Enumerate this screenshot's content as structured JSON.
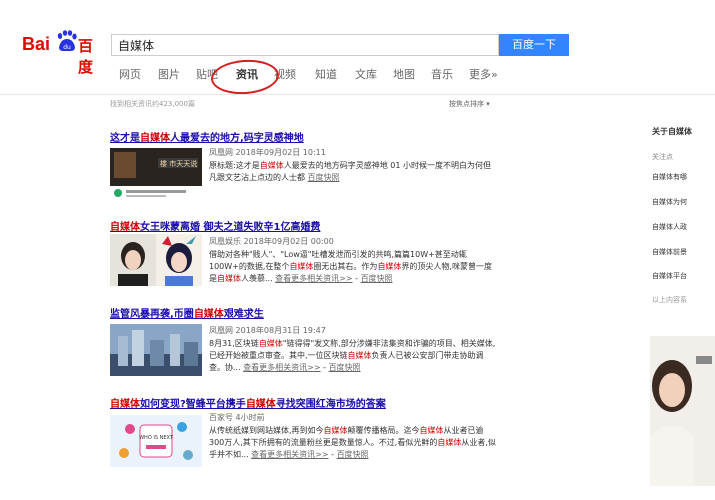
{
  "logo": {
    "latin": "Bai",
    "chinese": "百度",
    "paw_text": "du"
  },
  "search": {
    "value": "自媒体",
    "button": "百度一下"
  },
  "tabs": [
    {
      "label": "网页",
      "active": false
    },
    {
      "label": "图片",
      "active": false
    },
    {
      "label": "贴吧",
      "active": false
    },
    {
      "label": "资讯",
      "active": true
    },
    {
      "label": "视频",
      "active": false
    },
    {
      "label": "知道",
      "active": false
    },
    {
      "label": "文库",
      "active": false
    },
    {
      "label": "地图",
      "active": false
    },
    {
      "label": "音乐",
      "active": false
    },
    {
      "label": "更多»",
      "active": false
    }
  ],
  "result_count": "找到相关资讯约423,000篇",
  "sort_label": "按焦点排序",
  "results": [
    {
      "title_parts": [
        {
          "t": "这才是"
        },
        {
          "t": "自媒体",
          "em": true
        },
        {
          "t": "人最爱去的地方,码字灵感神地"
        }
      ],
      "meta": "凤凰网   2018年09月02日  10:11",
      "snippet": [
        {
          "t": "原标题:这才是"
        },
        {
          "t": "自媒体",
          "em": true
        },
        {
          "t": "人最爱去的地方码字灵感神地 01 小时候一度不明白为何但凡跟文艺沾上点边的人士都 "
        },
        {
          "t": "百度快照",
          "link": true
        }
      ],
      "thumb_text": "楼 市天天说"
    },
    {
      "title_parts": [
        {
          "t": "自媒体",
          "em": true
        },
        {
          "t": "女王咪蒙离婚 御夫之道失败辛1亿高婚费"
        }
      ],
      "meta": "凤凰娱乐   2018年09月02日  00:00",
      "snippet": [
        {
          "t": "借助对各种\"贱人\"、\"Low逼\"吐槽发泄而引发的共鸣,篇篇10W+甚至动辄100W+的数据,在整个"
        },
        {
          "t": "自媒体",
          "em": true
        },
        {
          "t": "圈无出其右。作为"
        },
        {
          "t": "自媒体",
          "em": true
        },
        {
          "t": "界的顶尖人物,咪蒙曾一度是"
        },
        {
          "t": "自媒体",
          "em": true
        },
        {
          "t": "人羡慕... "
        },
        {
          "t": "查看更多相关资讯>>",
          "link": true
        },
        {
          "t": "  -  "
        },
        {
          "t": "百度快照",
          "link": true
        }
      ],
      "thumb_text": ""
    },
    {
      "title_parts": [
        {
          "t": "监管风暴再袭,币圈"
        },
        {
          "t": "自媒体",
          "em": true
        },
        {
          "t": "艰难求生"
        }
      ],
      "meta": "凤凰网   2018年08月31日  19:47",
      "snippet": [
        {
          "t": "8月31,区块链"
        },
        {
          "t": "自媒体",
          "em": true
        },
        {
          "t": "\"链得得\"发文称,部分涉嫌非法集资和诈骗的项目、相关媒体,已经开始被重点审查。其中,一位区块链"
        },
        {
          "t": "自媒体",
          "em": true
        },
        {
          "t": "负责人已被公安部门带走协助调查。协... "
        },
        {
          "t": "查看更多相关资讯>>",
          "link": true
        },
        {
          "t": "  -  "
        },
        {
          "t": "百度快照",
          "link": true
        }
      ],
      "thumb_text": ""
    },
    {
      "title_parts": [
        {
          "t": "自媒体",
          "em": true
        },
        {
          "t": "如何变现?智蜂平台携手"
        },
        {
          "t": "自媒体",
          "em": true
        },
        {
          "t": "寻找突围红海市场的答案"
        }
      ],
      "meta": "百家号   4小时前",
      "snippet": [
        {
          "t": "从传统纸媒到网站媒体,再到如今"
        },
        {
          "t": "自媒体",
          "em": true
        },
        {
          "t": "颠覆传播格局。迄今"
        },
        {
          "t": "自媒体",
          "em": true
        },
        {
          "t": "从业者已逾300万人,其下所拥有的流量粉丝更是数量惊人。不过,看似光鲜的"
        },
        {
          "t": "自媒体",
          "em": true
        },
        {
          "t": "从业者,似乎并不如... "
        },
        {
          "t": "查看更多相关资讯>>",
          "link": true
        },
        {
          "t": "  -  "
        },
        {
          "t": "百度快照",
          "link": true
        }
      ],
      "thumb_text": "WHO IS NEXT"
    }
  ],
  "sidebar": {
    "title": "关于自媒体",
    "subtitle": "关注点",
    "items": [
      "自媒体有哪",
      "自媒体为何",
      "自媒体人政",
      "自媒体前景",
      "自媒体平台"
    ],
    "note": "以上内容系"
  },
  "colors": {
    "accent": "#3385ff",
    "brand_red": "#e10601",
    "link": "#1a0dab",
    "highlight": "#cc0000",
    "annotation": "#d21f1f"
  }
}
